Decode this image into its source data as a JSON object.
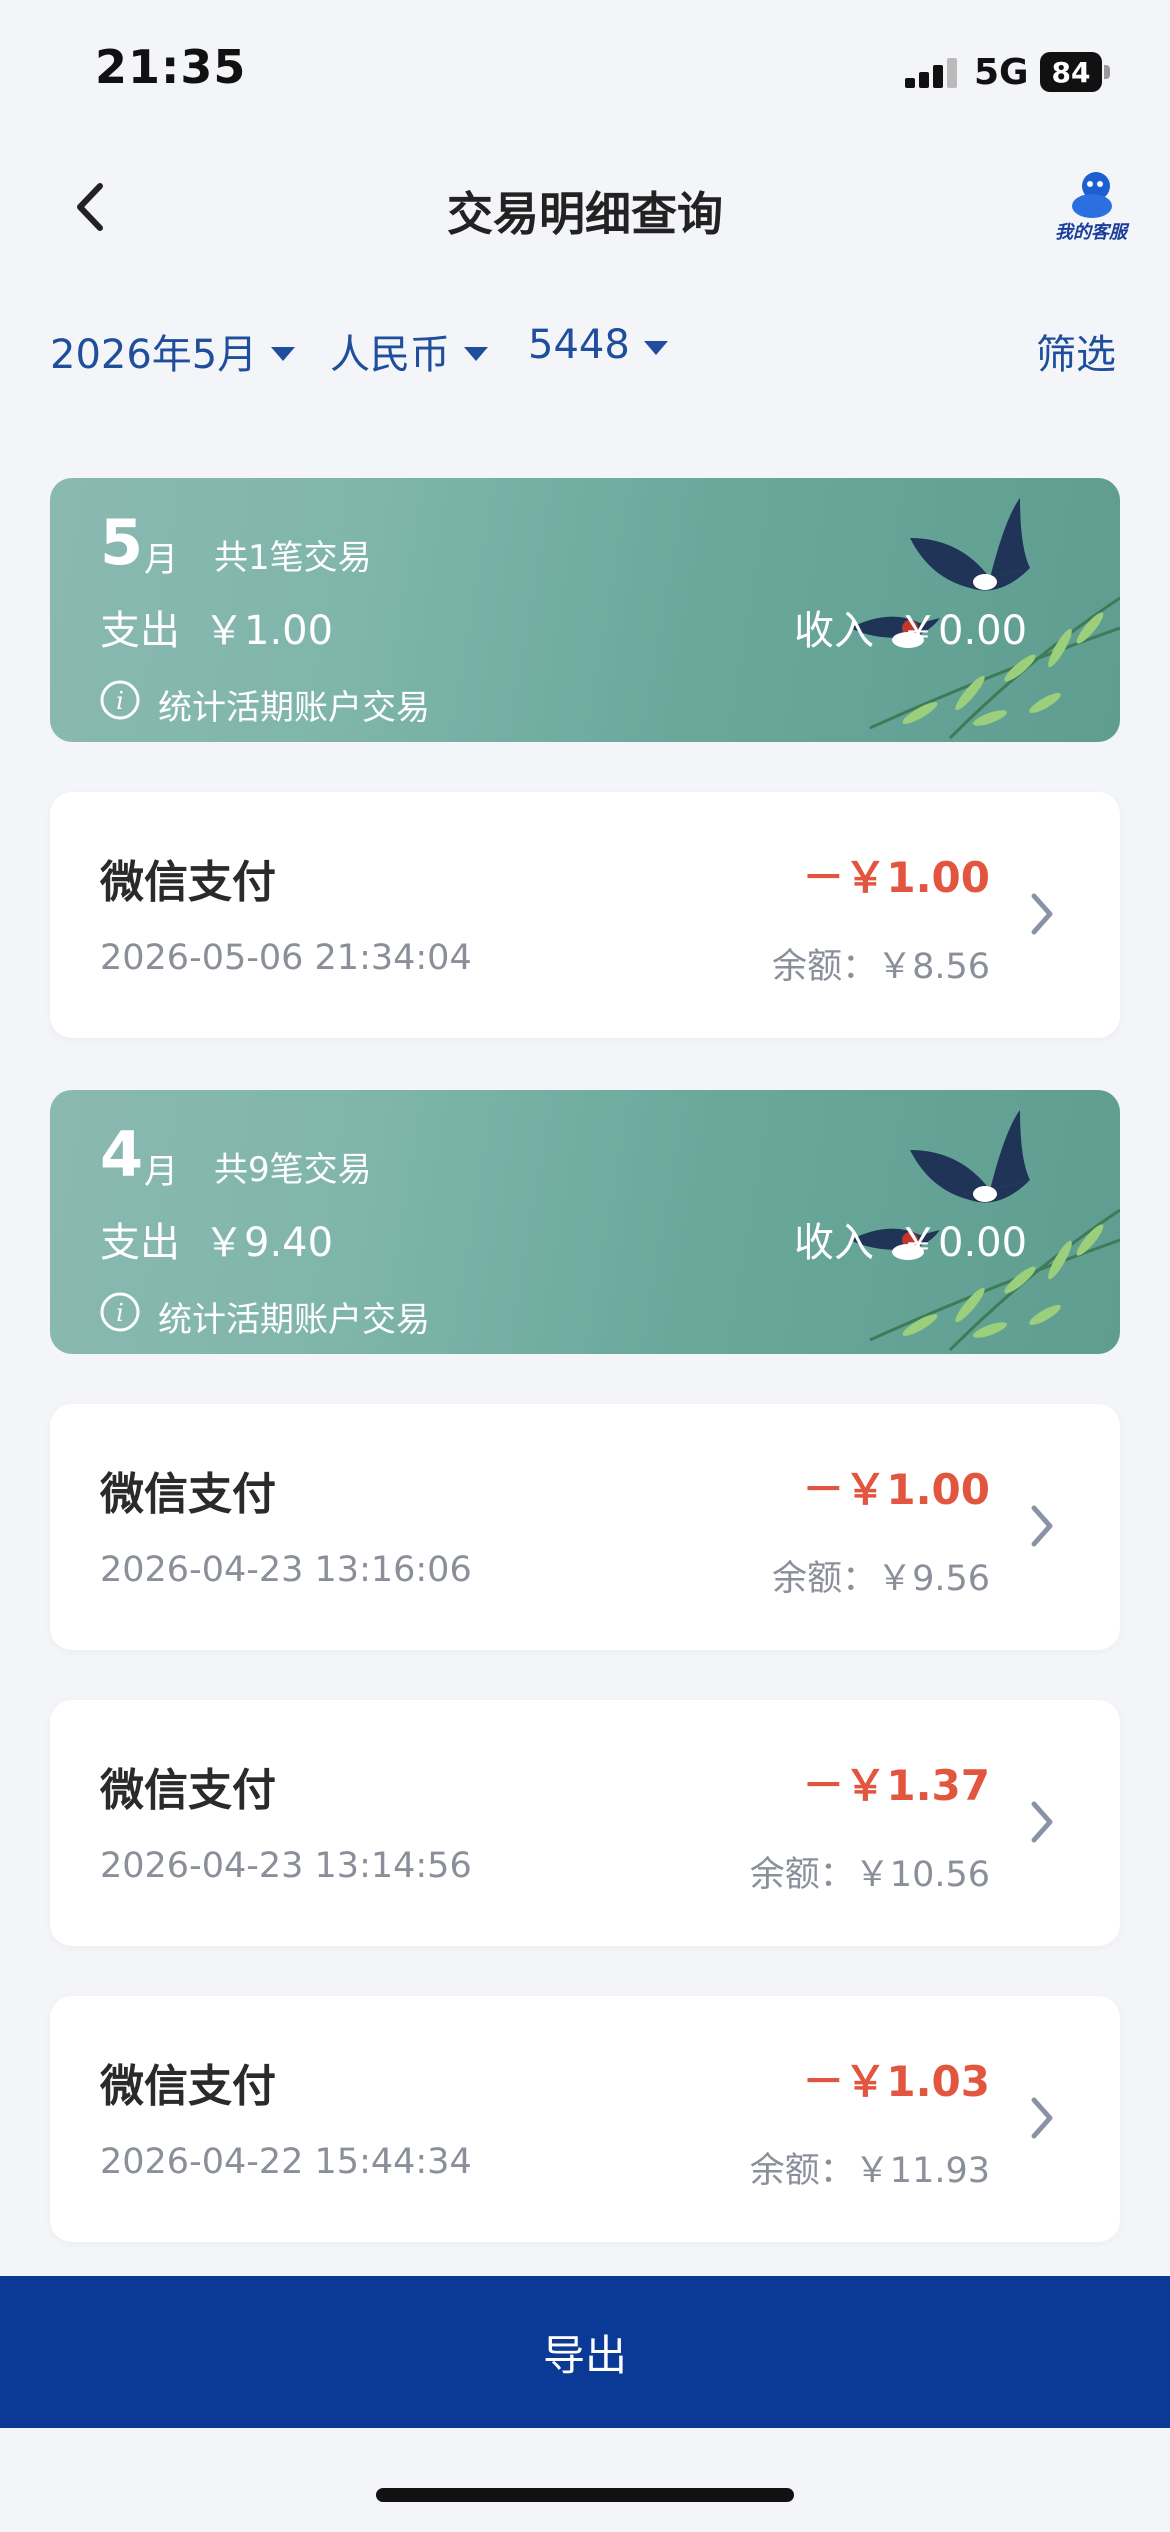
{
  "status_bar": {
    "time": "21:35",
    "network": "5G",
    "battery": "84"
  },
  "nav": {
    "title": "交易明细查询",
    "customer_service_label": "我的客服"
  },
  "filters": {
    "month": "2026年5月",
    "currency": "人民币",
    "card": "5448",
    "filter_label": "筛选"
  },
  "groups": [
    {
      "month_num": "5",
      "month_unit": "月",
      "count_text": "共1笔交易",
      "spend_label": "支出",
      "spend_value": "￥1.00",
      "income_label": "收入",
      "income_value": "￥0.00",
      "note": "统计活期账户交易",
      "transactions": [
        {
          "merchant": "微信支付",
          "datetime": "2026-05-06 21:34:04",
          "amount": "－￥1.00",
          "balance": "余额：￥8.56"
        }
      ]
    },
    {
      "month_num": "4",
      "month_unit": "月",
      "count_text": "共9笔交易",
      "spend_label": "支出",
      "spend_value": "￥9.40",
      "income_label": "收入",
      "income_value": "￥0.00",
      "note": "统计活期账户交易",
      "transactions": [
        {
          "merchant": "微信支付",
          "datetime": "2026-04-23 13:16:06",
          "amount": "－￥1.00",
          "balance": "余额：￥9.56"
        },
        {
          "merchant": "微信支付",
          "datetime": "2026-04-23 13:14:56",
          "amount": "－￥1.37",
          "balance": "余额：￥10.56"
        },
        {
          "merchant": "微信支付",
          "datetime": "2026-04-22 15:44:34",
          "amount": "－￥1.03",
          "balance": "余额：￥11.93"
        }
      ]
    }
  ],
  "export_label": "导出",
  "colors": {
    "brand_blue": "#0b3a96",
    "link_blue": "#1e4e9c",
    "expense_red": "#e2553f",
    "card_teal": "#6aa89c"
  }
}
